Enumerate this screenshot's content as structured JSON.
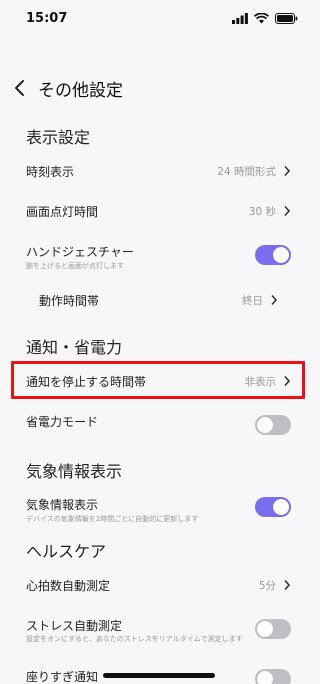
{
  "status_bar": {
    "time": "15:07"
  },
  "header": {
    "title": "その他設定"
  },
  "sections": {
    "display": {
      "title": "表示設定"
    },
    "notify": {
      "title": "通知・省電力"
    },
    "weather": {
      "title": "気象情報表示"
    },
    "health": {
      "title": "ヘルスケア"
    }
  },
  "rows": {
    "time_display": {
      "label": "時刻表示",
      "value": "24 時間形式"
    },
    "screen_on": {
      "label": "画面点灯時間",
      "value": "30 秒"
    },
    "hand_gesture": {
      "label": "ハンドジェスチャー",
      "sub": "腕を上げると画面が点灯します",
      "on": true
    },
    "active_hours": {
      "label": "動作時間帯",
      "value": "終日"
    },
    "dnd_hours": {
      "label": "通知を停止する時間帯",
      "value": "非表示"
    },
    "power_save": {
      "label": "省電力モード",
      "on": false
    },
    "weather_display": {
      "label": "気象情報表示",
      "sub": "デバイスの気象情報を2時間ごとに自動的に更新します",
      "on": true
    },
    "hr_auto": {
      "label": "心拍数自動測定",
      "value": "5分"
    },
    "stress_auto": {
      "label": "ストレス自動測定",
      "sub": "設定をオンにすると、あなたのストレスをリアルタイムで測定します",
      "on": false
    },
    "sedentary": {
      "label": "座りすぎ通知",
      "on": false
    }
  },
  "colors": {
    "toggle_on": "#7b6df0",
    "toggle_off": "#bfbfc3",
    "highlight": "#ee1111"
  }
}
